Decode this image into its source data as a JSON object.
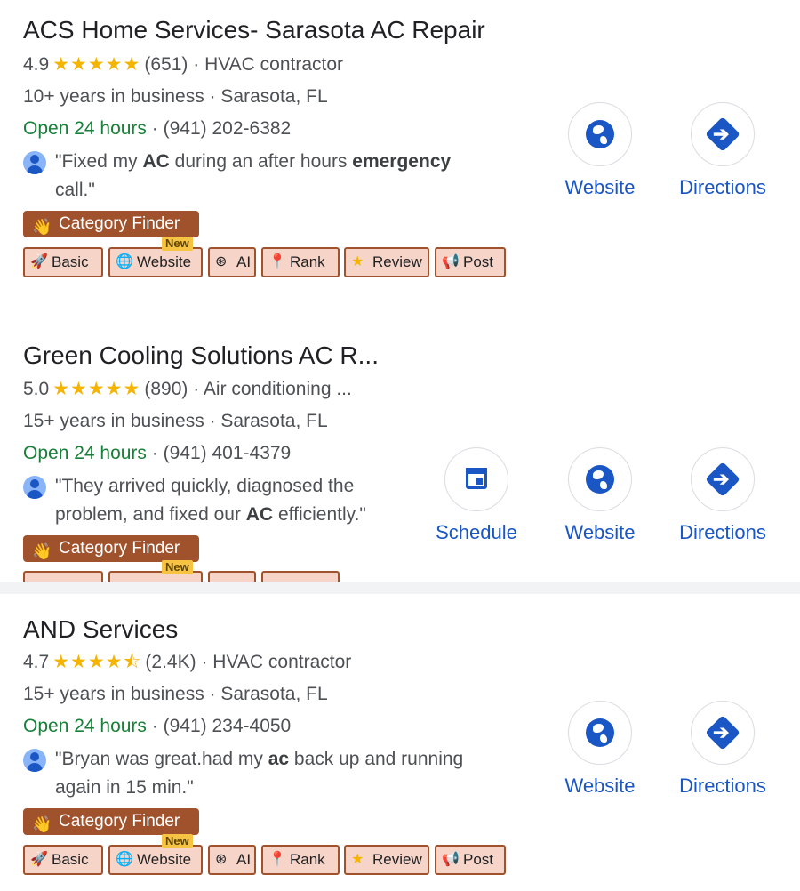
{
  "listings": [
    {
      "title": "ACS Home Services- Sarasota AC Repair",
      "rating": "4.9",
      "stars": "★★★★★",
      "reviews_count": "(651)",
      "category": "HVAC contractor",
      "years": "10+ years in business",
      "location": "Sarasota, FL",
      "hours": "Open 24 hours",
      "phone": "(941) 202-6382",
      "review_parts": [
        "\"Fixed my ",
        "AC",
        " during an after hours ",
        "emergency",
        " call.\""
      ],
      "actions": [
        "Website",
        "Directions"
      ]
    },
    {
      "title": "Green Cooling Solutions AC R...",
      "rating": "5.0",
      "stars": "★★★★★",
      "reviews_count": "(890)",
      "category": "Air conditioning ...",
      "years": "15+ years in business",
      "location": "Sarasota, FL",
      "hours": "Open 24 hours",
      "phone": "(941) 401-4379",
      "review_parts": [
        "\"They arrived quickly, diagnosed the problem, and fixed our ",
        "AC",
        " efficiently.\""
      ],
      "actions": [
        "Schedule",
        "Website",
        "Directions"
      ]
    },
    {
      "title": "AND Services",
      "rating": "4.7",
      "stars": "★★★★⯪",
      "reviews_count": "(2.4K)",
      "category": "HVAC contractor",
      "years": "15+ years in business",
      "location": "Sarasota, FL",
      "hours": "Open 24 hours",
      "phone": "(941) 234-4050",
      "review_parts": [
        "\"Bryan was great.had my ",
        "ac",
        " back up and running again in 15 min.\""
      ],
      "actions": [
        "Website",
        "Directions"
      ]
    }
  ],
  "extension": {
    "category_finder": "Category Finder",
    "new_badge": "New",
    "chips": [
      "Basic",
      "Website",
      "AI",
      "Rank",
      "Review",
      "Post"
    ]
  },
  "separator": "·",
  "colors": {
    "link_blue": "#1a56c4",
    "open_green": "#188038",
    "star_gold": "#f4b400",
    "chip_border": "#a0522d",
    "chip_bg": "#f6d5c8"
  },
  "icons": {
    "website": "globe-icon",
    "directions": "directions-icon",
    "schedule": "calendar-icon",
    "review_avatar": "user-avatar-icon"
  }
}
